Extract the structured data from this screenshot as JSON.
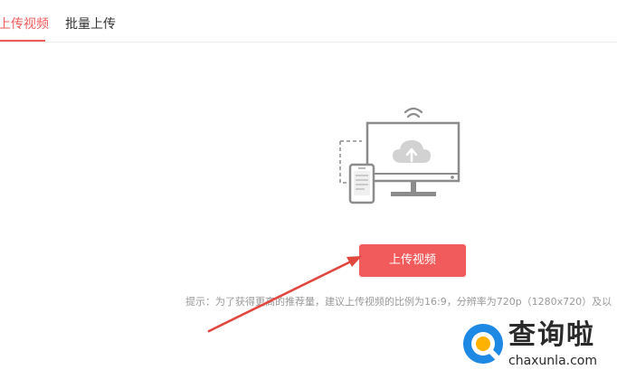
{
  "tabs": [
    {
      "label": "上传视频",
      "active": true
    },
    {
      "label": "批量上传",
      "active": false
    }
  ],
  "upload_button_label": "上传视频",
  "hint_text": "提示：为了获得更高的推荐量，建议上传视频的比例为16:9，分辨率为720p（1280x720）及以",
  "watermark": {
    "title": "查询啦",
    "subtitle": "chaxunla.com"
  },
  "colors": {
    "accent": "#f25b5b",
    "hint": "#999999",
    "icon_stroke": "#8c8c8c"
  },
  "icons": {
    "illustration": "monitor-phone-upload-icon",
    "wifi": "wifi-icon",
    "cloud": "cloud-upload-icon",
    "arrow": "annotation-arrow"
  }
}
